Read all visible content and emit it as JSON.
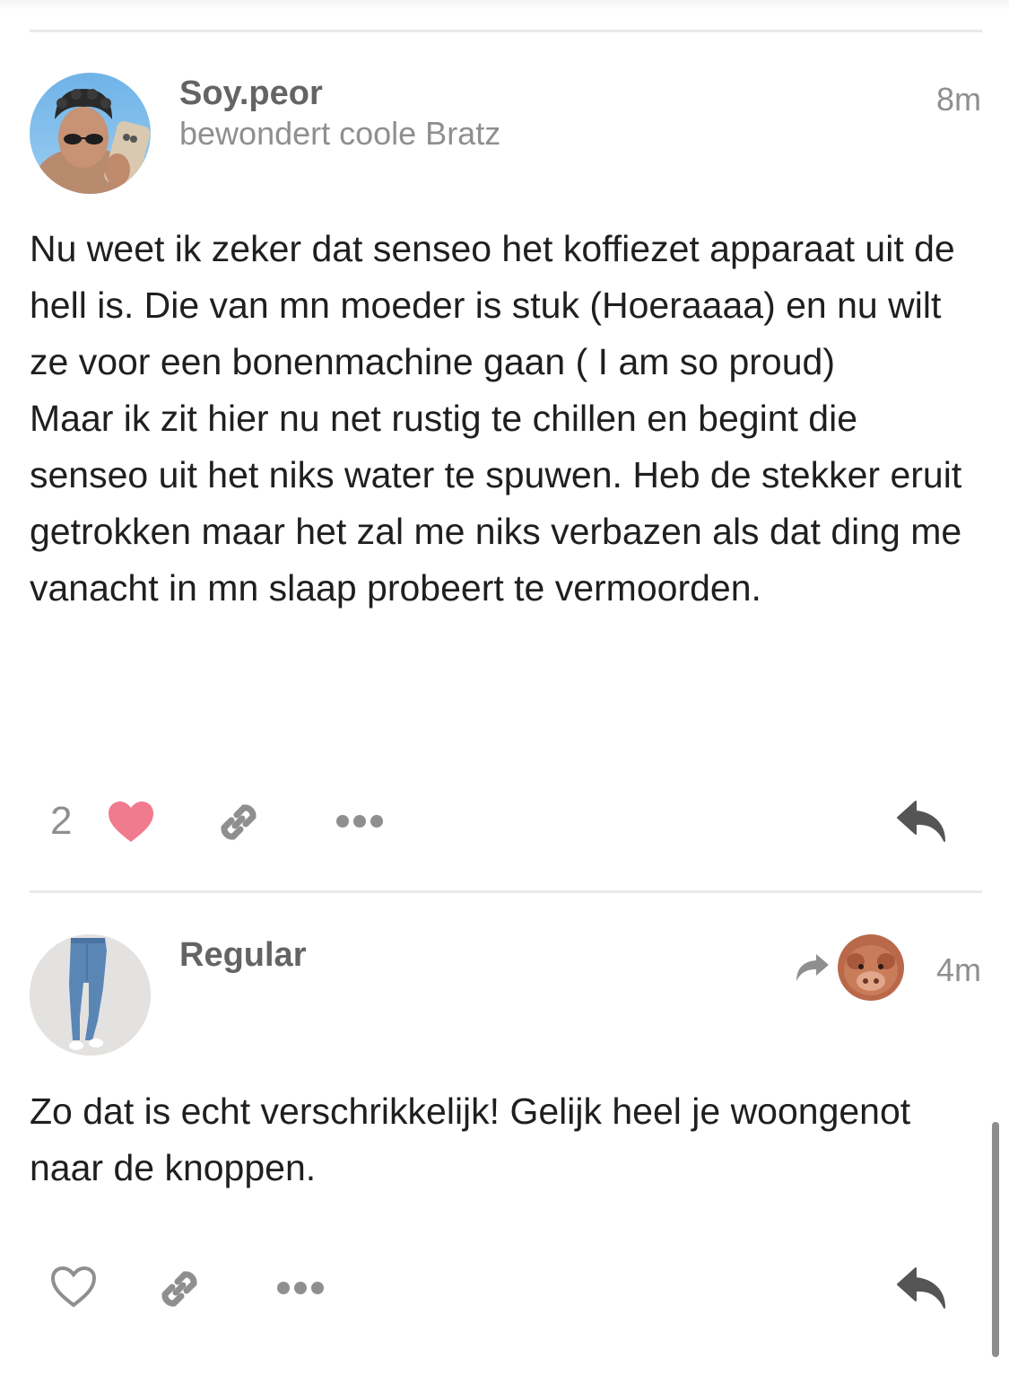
{
  "posts": [
    {
      "username": "Soy.peor",
      "user_title": "bewondert coole Bratz",
      "time": "8m",
      "avatar_icon": "user-avatar-selfie",
      "body": [
        "Nu weet ik zeker dat senseo het koffiezet apparaat uit de hell is. Die van mn moeder is stuk (Hoeraaaa) en nu wilt ze voor een bonenmachine gaan ( I am so proud)",
        "Maar ik zit hier nu net rustig te chillen en begint die senseo uit het niks water te spuwen. Heb de stekker eruit getrokken maar het zal me niks verbazen als dat ding me vanacht in mn slaap probeert te vermoorden."
      ],
      "like_count": "2",
      "liked": true
    },
    {
      "username": "Regular",
      "time": "4m",
      "avatar_icon": "user-avatar-jeans",
      "reply_to_avatar_icon": "user-avatar-cow",
      "body": [
        "Zo dat is echt verschrikkelijk! Gelijk heel je woongenot naar de knoppen."
      ],
      "liked": false
    }
  ],
  "colors": {
    "heart_liked": "#f07a8e",
    "icon_gray": "#8f8f8f",
    "reply_icon": "#555555",
    "divider": "#e9e9e9"
  },
  "icons": [
    "heart-icon",
    "link-icon",
    "more-icon",
    "reply-icon",
    "reply-to-arrow-icon"
  ]
}
